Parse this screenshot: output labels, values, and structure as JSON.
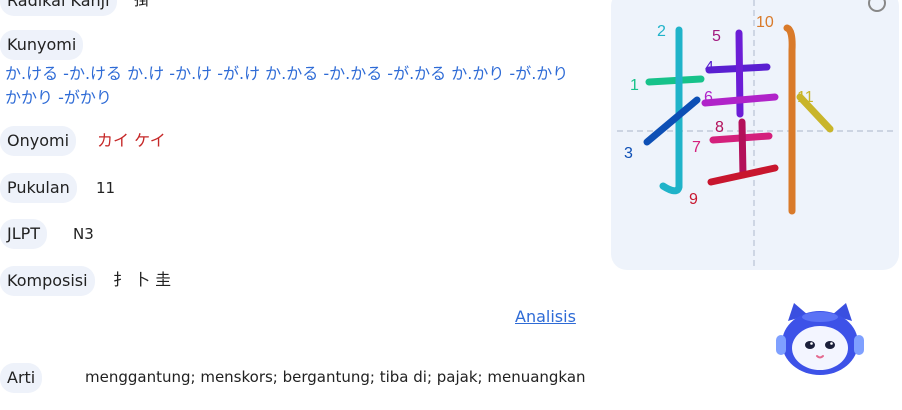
{
  "radikal": {
    "label": "Radikal Kanji",
    "value": "掛"
  },
  "kunyomi": {
    "label": "Kunyomi",
    "value": "か.ける  -か.ける  か.け  -か.け  -が.け  か.かる  -か.かる  -が.かる  か.かり  -が.かり  かかり  -がかり"
  },
  "onyomi": {
    "label": "Onyomi",
    "value": "カイ  ケイ"
  },
  "pukulan": {
    "label": "Pukulan",
    "value": "11"
  },
  "jlpt": {
    "label": "JLPT",
    "value": "N3"
  },
  "komposisi": {
    "label": "Komposisi",
    "value": "扌 卜 圭"
  },
  "analisis_link": "Analisis",
  "arti": {
    "label": "Arti",
    "value": "menggantung; menskors; bergantung; tiba di; pajak; menuangkan"
  },
  "stroke_numbers": [
    "1",
    "2",
    "3",
    "4",
    "5",
    "6",
    "7",
    "8",
    "9",
    "10",
    "11"
  ],
  "colors": {
    "pill_bg": "#eef2fa",
    "link": "#2e6bd6",
    "onyomi": "#c62828",
    "panel_bg": "#eef3fb"
  }
}
